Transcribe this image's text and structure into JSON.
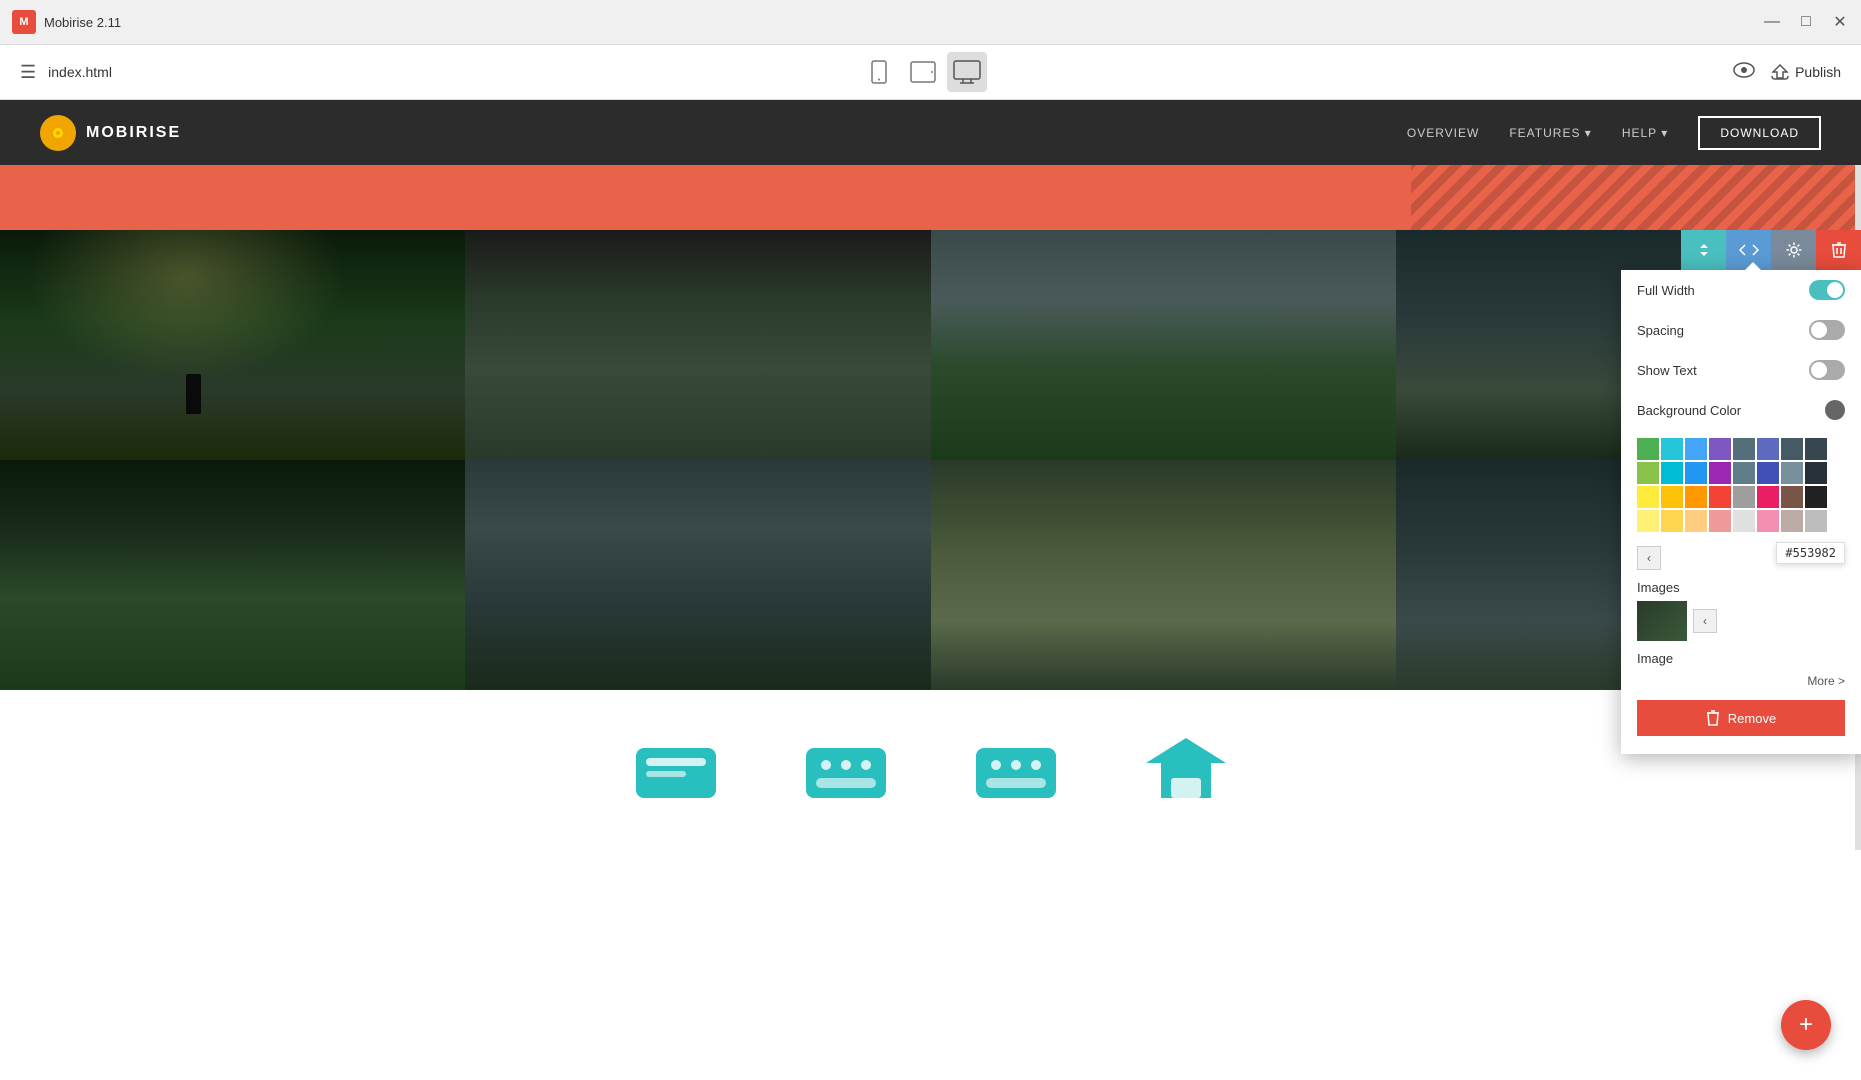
{
  "titlebar": {
    "logo_text": "M",
    "app_name": "Mobirise 2.11",
    "minimize_icon": "—",
    "maximize_icon": "□",
    "close_icon": "✕"
  },
  "toolbar": {
    "menu_icon": "☰",
    "filename": "index.html",
    "device_mobile_icon": "📱",
    "device_tablet_icon": "📟",
    "device_desktop_icon": "🖥",
    "eye_icon": "👁",
    "cloud_icon": "☁",
    "publish_label": "Publish"
  },
  "preview_navbar": {
    "logo_text": "MOBIRISE",
    "nav_links": [
      "OVERVIEW",
      "FEATURES ▾",
      "HELP ▾"
    ],
    "download_label": "DOWNLOAD"
  },
  "block_toolbar": {
    "arrows_icon": "⇅",
    "code_icon": "</>",
    "gear_icon": "⚙",
    "trash_icon": "🗑"
  },
  "settings_panel": {
    "full_width_label": "Full Width",
    "full_width_state": "on",
    "spacing_label": "Spacing",
    "spacing_state": "off",
    "show_text_label": "Show Text",
    "show_text_state": "off",
    "bg_color_label": "Background Color",
    "images_label": "Images",
    "image_label": "Image",
    "more_label": "More >",
    "color_hex": "#553982",
    "remove_label": "Remove",
    "trash_icon": "🗑"
  },
  "color_palette": {
    "rows": [
      [
        "#4caf50",
        "#00bcd4",
        "#2196f3",
        "#9c27b0",
        "#607d8b"
      ],
      [
        "#8bc34a",
        "#26c6da",
        "#42a5f5",
        "#ab47bc",
        "#546e7a"
      ],
      [
        "#ffeb3b",
        "#ffca28",
        "#ffa726",
        "#ef5350",
        "#bdbdbd"
      ],
      [
        "#fff176",
        "#ffd54f",
        "#ffcc80",
        "#ef9a9a",
        "#e0e0e0"
      ],
      [
        "#ffffff",
        "#f5f5f5",
        "#9e9e9e",
        "#616161",
        "#000000"
      ]
    ]
  },
  "fab": {
    "icon": "+"
  }
}
